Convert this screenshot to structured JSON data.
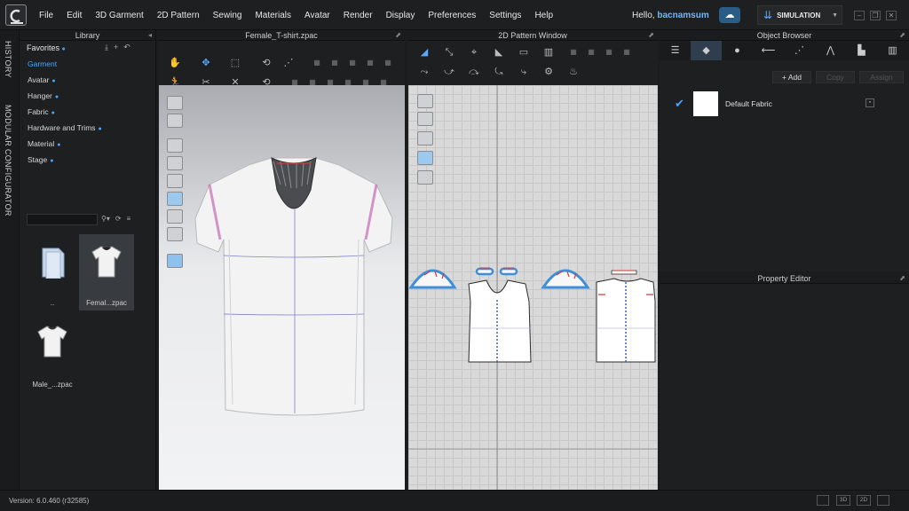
{
  "app": {
    "logo": "C"
  },
  "menu": [
    "File",
    "Edit",
    "3D Garment",
    "2D Pattern",
    "Sewing",
    "Materials",
    "Avatar",
    "Render",
    "Display",
    "Preferences",
    "Settings",
    "Help"
  ],
  "user": {
    "greeting": "Hello,",
    "name": "bacnamsum"
  },
  "mode_button": {
    "label": "SIMULATION"
  },
  "window_controls": {
    "minimize": "–",
    "restore": "❐",
    "close": "✕"
  },
  "side_tabs": {
    "history": "HISTORY",
    "modular": "MODULAR CONFIGURATOR"
  },
  "library": {
    "title": "Library",
    "favorites": "Favorites",
    "categories": [
      {
        "label": "Garment",
        "active": true
      },
      {
        "label": "Avatar"
      },
      {
        "label": "Hanger"
      },
      {
        "label": "Fabric"
      },
      {
        "label": "Hardware and Trims"
      },
      {
        "label": "Material"
      },
      {
        "label": "Stage"
      }
    ],
    "files": [
      {
        "label": ".."
      },
      {
        "label": "Femal...zpac"
      },
      {
        "label": "Male_...zpac"
      }
    ]
  },
  "viewport3d": {
    "title": "Female_T-shirt.zpac"
  },
  "pattern2d": {
    "title": "2D Pattern Window"
  },
  "object_browser": {
    "title": "Object Browser",
    "add": "+ Add",
    "copy": "Copy",
    "assign": "Assign",
    "fabric": "Default Fabric"
  },
  "property_editor": {
    "title": "Property Editor"
  },
  "status": {
    "version": "Version: 6.0.460 (r32585)",
    "btn_3d": "3D",
    "btn_2d": "2D"
  },
  "colors": {
    "accent": "#4aa5ff",
    "pattern_outline": "#3f8fd8",
    "stitch": "#d43b3b"
  }
}
